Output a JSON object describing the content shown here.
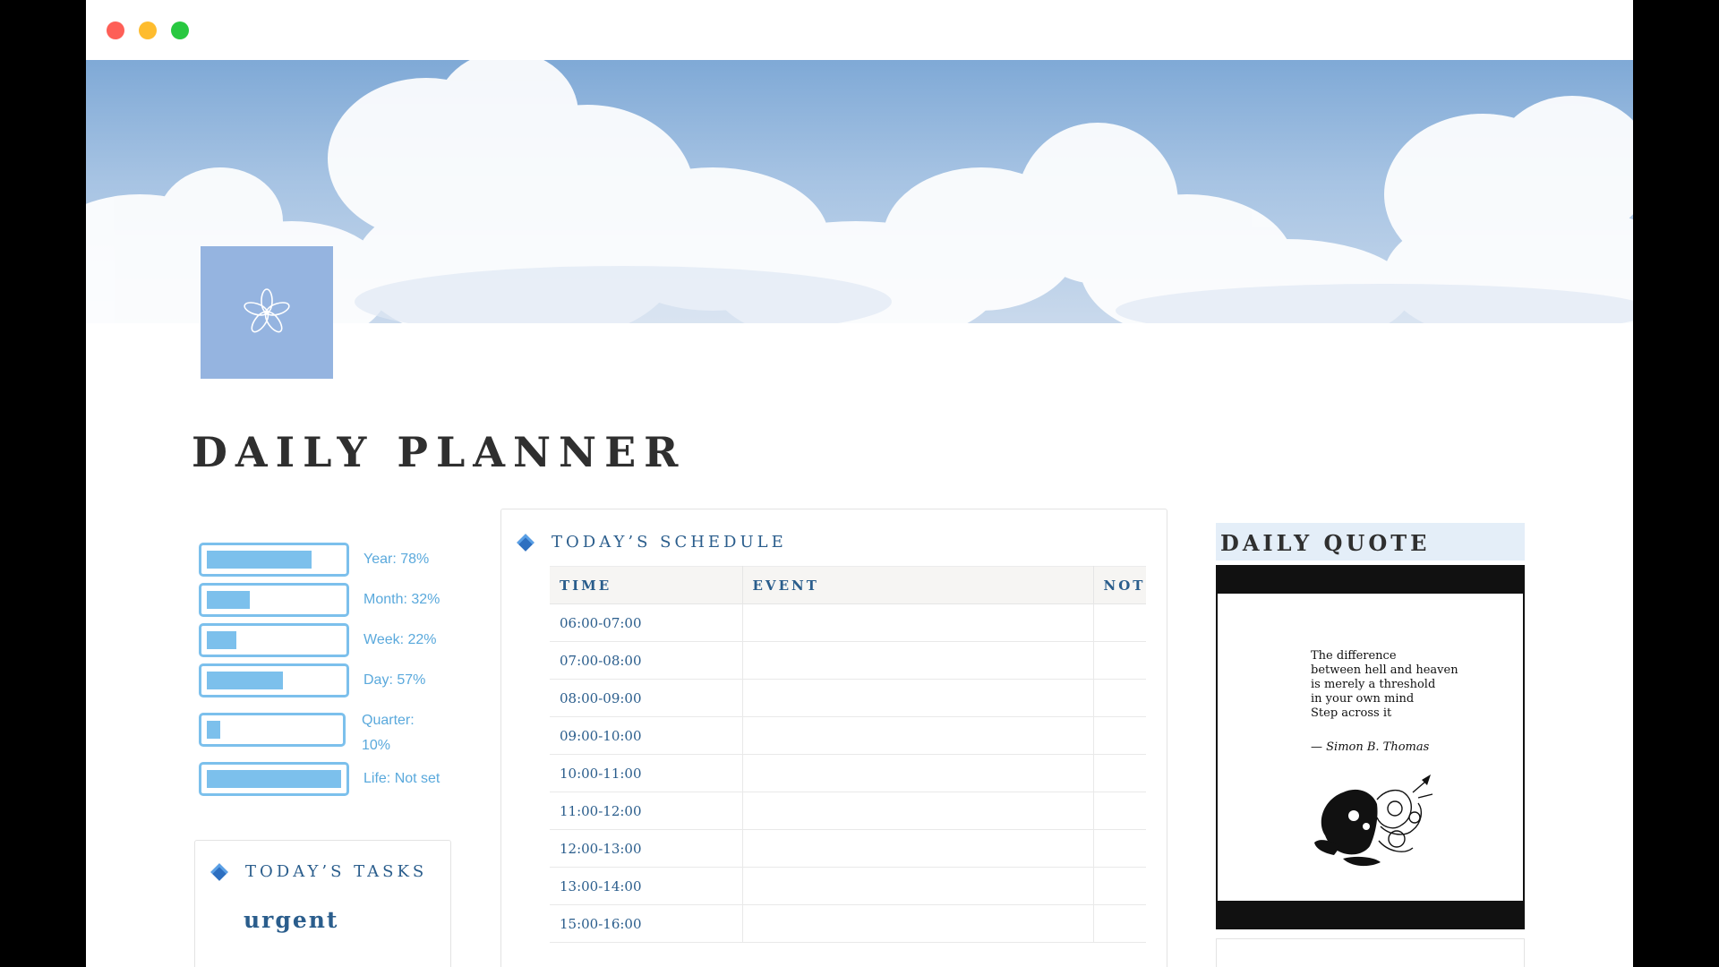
{
  "page": {
    "title": "DAILY PLANNER",
    "icon": "flower-icon"
  },
  "progress": [
    {
      "label": "Year: 78%",
      "fill": 0.78
    },
    {
      "label": "Month: 32%",
      "fill": 0.32
    },
    {
      "label": "Week: 22%",
      "fill": 0.22
    },
    {
      "label": "Day: 57%",
      "fill": 0.57
    },
    {
      "label": "Quarter: 10%",
      "fill": 0.1
    },
    {
      "label": "Life: Not set",
      "fill": 1.0
    }
  ],
  "tasks": {
    "heading": "TODAY’S TASKS",
    "group": "urgent"
  },
  "schedule": {
    "heading": "TODAY’S SCHEDULE",
    "columns": [
      "TIME",
      "EVENT",
      "NOT"
    ],
    "rows": [
      "06:00-07:00",
      "07:00-08:00",
      "08:00-09:00",
      "09:00-10:00",
      "10:00-11:00",
      "11:00-12:00",
      "12:00-13:00",
      "13:00-14:00",
      "15:00-16:00"
    ]
  },
  "quote": {
    "heading": "DAILY QUOTE",
    "lines": [
      "The difference",
      "between hell and heaven",
      "is merely a threshold",
      "in your own mind",
      "Step across it"
    ],
    "author": "— Simon B. Thomas"
  },
  "colors": {
    "accent": "#2a5d8c",
    "progress": "#7cc0ec",
    "icon_bg": "#95b4e0",
    "quote_header_bg": "#e4eef8"
  }
}
